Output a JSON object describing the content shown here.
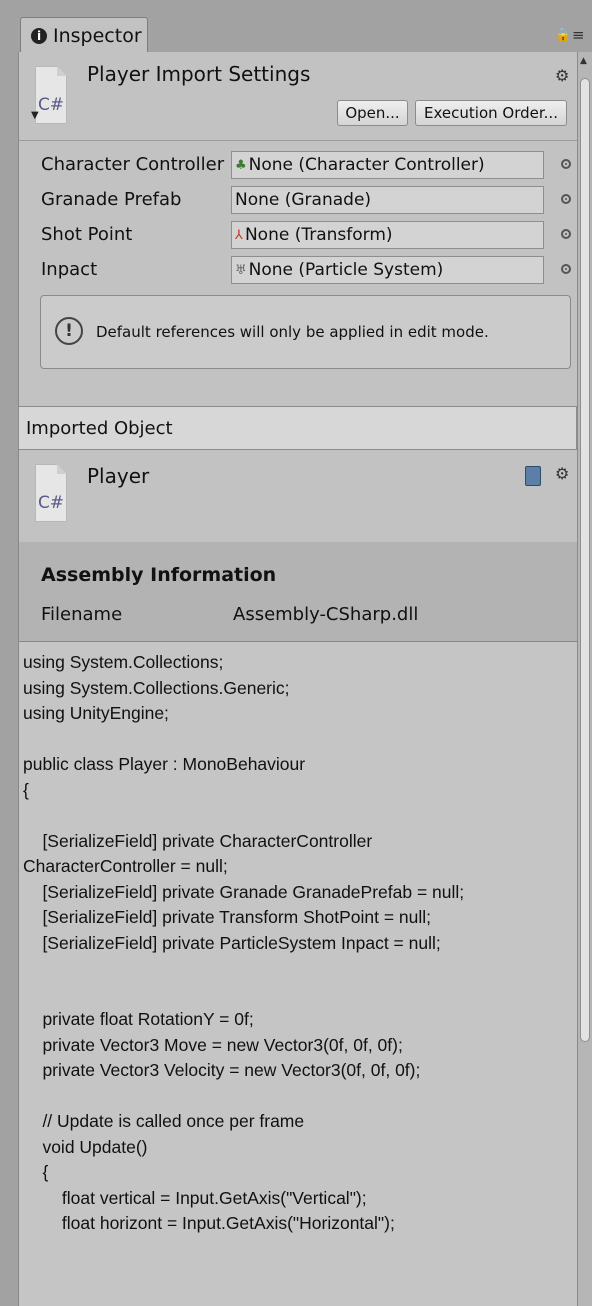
{
  "tab": {
    "label": "Inspector"
  },
  "header": {
    "title": "Player Import Settings",
    "icon_text": "C#",
    "open_button": "Open...",
    "execution_order_button": "Execution Order..."
  },
  "properties": [
    {
      "label": "Character Controller",
      "value": "None (Character Controller)",
      "icon": "character-controller-icon"
    },
    {
      "label": "Granade Prefab",
      "value": "None (Granade)",
      "icon": ""
    },
    {
      "label": "Shot Point",
      "value": "None (Transform)",
      "icon": "transform-icon"
    },
    {
      "label": "Inpact",
      "value": "None (Particle System)",
      "icon": "particle-system-icon"
    }
  ],
  "help_message": "Default references will only be applied in edit mode.",
  "imported_object": {
    "section_label": "Imported Object",
    "title": "Player",
    "icon_text": "C#"
  },
  "assembly": {
    "title": "Assembly Information",
    "filename_label": "Filename",
    "filename_value": "Assembly-CSharp.dll"
  },
  "code": "using System.Collections;\nusing System.Collections.Generic;\nusing UnityEngine;\n\npublic class Player : MonoBehaviour\n{\n\n    [SerializeField] private CharacterController\nCharacterController = null;\n    [SerializeField] private Granade GranadePrefab = null;\n    [SerializeField] private Transform ShotPoint = null;\n    [SerializeField] private ParticleSystem Inpact = null;\n\n\n    private float RotationY = 0f;\n    private Vector3 Move = new Vector3(0f, 0f, 0f);\n    private Vector3 Velocity = new Vector3(0f, 0f, 0f);\n\n    // Update is called once per frame\n    void Update()\n    {\n        float vertical = Input.GetAxis(\"Vertical\");\n        float horizont = Input.GetAxis(\"Horizontal\");"
}
